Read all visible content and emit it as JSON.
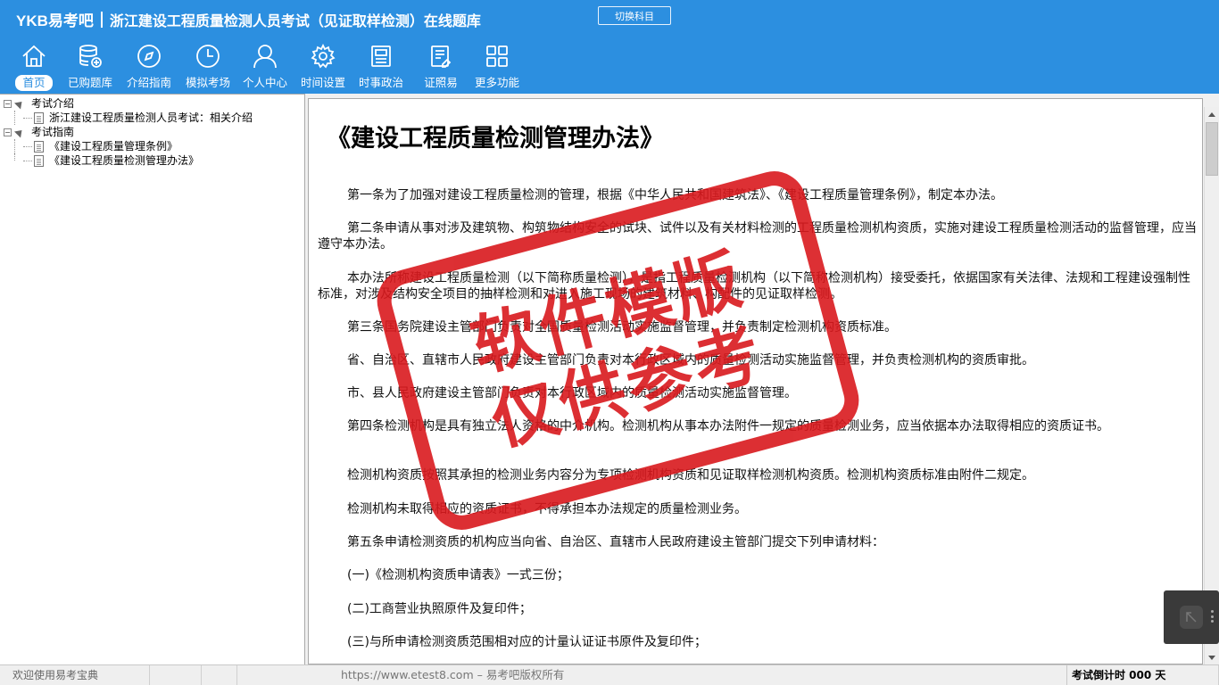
{
  "header": {
    "logo_text": "YKB易考吧",
    "title": "浙江建设工程质量检测人员考试（见证取样检测）在线题库",
    "switch_subject": "切换科目"
  },
  "nav": [
    {
      "label": "首页",
      "icon": "home-icon",
      "active": true
    },
    {
      "label": "已购题库",
      "icon": "database-icon",
      "active": false
    },
    {
      "label": "介绍指南",
      "icon": "compass-icon",
      "active": false
    },
    {
      "label": "模拟考场",
      "icon": "clock-icon",
      "active": false
    },
    {
      "label": "个人中心",
      "icon": "user-icon",
      "active": false
    },
    {
      "label": "时间设置",
      "icon": "gear-icon",
      "active": false
    },
    {
      "label": "时事政治",
      "icon": "news-icon",
      "active": false
    },
    {
      "label": "证照易",
      "icon": "certificate-icon",
      "active": false
    },
    {
      "label": "更多功能",
      "icon": "grid-icon",
      "active": false
    }
  ],
  "tree": {
    "group1": "考试介绍",
    "item1": "浙江建设工程质量检测人员考试：相关介绍",
    "group2": "考试指南",
    "item2": "《建设工程质量管理条例》",
    "item3": "《建设工程质量检测管理办法》"
  },
  "document": {
    "title": "《建设工程质量检测管理办法》",
    "paragraphs": [
      "第一条为了加强对建设工程质量检测的管理，根据《中华人民共和国建筑法》、《建设工程质量管理条例》，制定本办法。",
      "第二条申请从事对涉及建筑物、构筑物结构安全的试块、试件以及有关材料检测的工程质量检测机构资质，实施对建设工程质量检测活动的监督管理，应当遵守本办法。",
      "本办法所称建设工程质量检测（以下简称质量检测），是指工程质量检测机构（以下简称检测机构）接受委托，依据国家有关法律、法规和工程建设强制性标准，对涉及结构安全项目的抽样检测和对进入施工现场的建筑材料、构配件的见证取样检测。",
      "第三条国务院建设主管部门负责对全国质量检测活动实施监督管理，并负责制定检测机构资质标准。",
      "省、自治区、直辖市人民政府建设主管部门负责对本行政区域内的质量检测活动实施监督管理，并负责检测机构的资质审批。",
      "市、县人民政府建设主管部门负责对本行政区域内的质量检测活动实施监督管理。",
      "第四条检测机构是具有独立法人资格的中介机构。检测机构从事本办法附件一规定的质量检测业务，应当依据本办法取得相应的资质证书。",
      "检测机构资质按照其承担的检测业务内容分为专项检测机构资质和见证取样检测机构资质。检测机构资质标准由附件二规定。",
      "检测机构未取得相应的资质证书，不得承担本办法规定的质量检测业务。",
      "第五条申请检测资质的机构应当向省、自治区、直辖市人民政府建设主管部门提交下列申请材料：",
      "(一)《检测机构资质申请表》一式三份；",
      "(二)工商营业执照原件及复印件；",
      "(三)与所申请检测资质范围相对应的计量认证证书原件及复印件；"
    ]
  },
  "watermark": {
    "line1": "软件模版",
    "line2": "仅供参考",
    "color": "#d9191e"
  },
  "status": {
    "welcome": "欢迎使用易考宝典",
    "copyright": "https://www.etest8.com – 易考吧版权所有",
    "countdown": "考试倒计时 000 天"
  },
  "colors": {
    "header_bg": "#2c8fe0",
    "accent": "#2c8fe0"
  }
}
